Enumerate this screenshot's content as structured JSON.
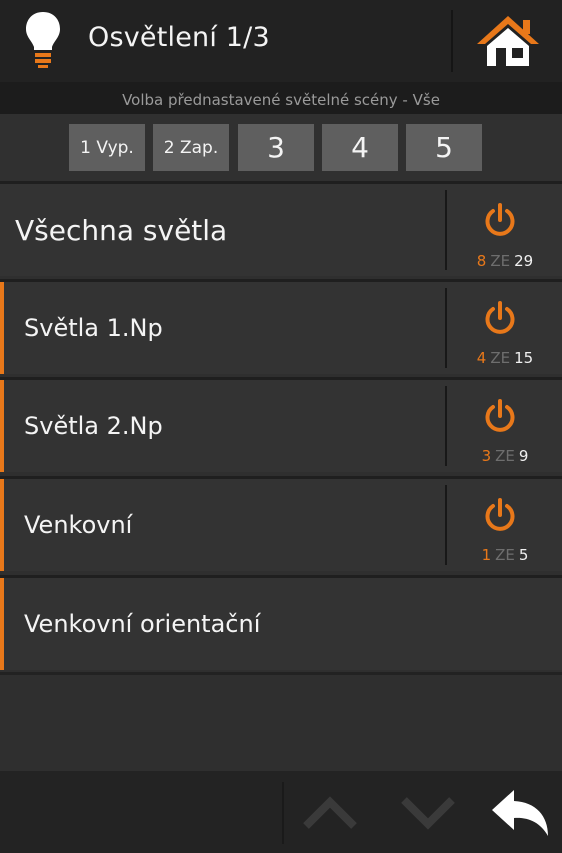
{
  "header": {
    "title": "Osvětlení 1/3",
    "icon": "light-bulb-icon",
    "home_icon": "home-icon"
  },
  "subtitle": "Volba přednastavené světelné scény - Vše",
  "scenes": [
    "1 Vyp.",
    "2 Zap.",
    "3",
    "4",
    "5"
  ],
  "groups": [
    {
      "label": "Všechna světla",
      "on": "8",
      "ze": "ZE",
      "total": "29",
      "has_power": true
    },
    {
      "label": "Světla 1.Np",
      "on": "4",
      "ze": "ZE",
      "total": "15",
      "has_power": true
    },
    {
      "label": "Světla 2.Np",
      "on": "3",
      "ze": "ZE",
      "total": "9",
      "has_power": true
    },
    {
      "label": "Venkovní",
      "on": "1",
      "ze": "ZE",
      "total": "5",
      "has_power": true
    },
    {
      "label": "Venkovní orientační",
      "has_power": false
    }
  ],
  "footer": {
    "up_icon": "chevron-up-icon",
    "down_icon": "chevron-down-icon",
    "back_icon": "back-arrow-icon"
  },
  "colors": {
    "accent": "#e8781a",
    "background": "#2f2f2f",
    "header": "#222222",
    "button": "#5f5f5f"
  }
}
